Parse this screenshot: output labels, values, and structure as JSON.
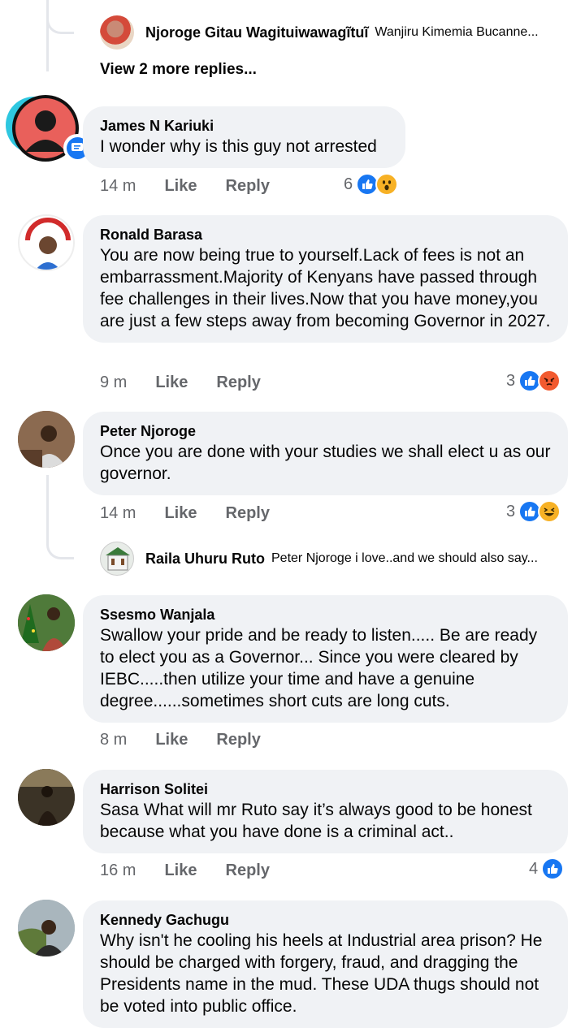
{
  "top_reply": {
    "author": "Njoroge Gitau Wagituiwawagĩtuĩ",
    "snippet": "Wanjiru Kimemia  Bucanne..."
  },
  "view_more_label": "View 2 more replies...",
  "comments": [
    {
      "author": "James N Kariuki",
      "text": "I wonder why is this guy not arrested",
      "time": "14 m",
      "like_label": "Like",
      "reply_label": "Reply",
      "reaction_count": "6",
      "reactions": [
        "like-icon",
        "wow-icon"
      ]
    },
    {
      "author": "Ronald Barasa",
      "text": "You are now being true to yourself.Lack of fees is not an embarrassment.Majority of Kenyans have passed through fee challenges in their lives.Now that you have money,you are just a few steps away from becoming Governor in 2027.",
      "time": "9 m",
      "like_label": "Like",
      "reply_label": "Reply",
      "reaction_count": "3",
      "reactions": [
        "like-icon",
        "angry-icon"
      ]
    },
    {
      "author": "Peter Njoroge",
      "text": "Once you are done with your studies we shall elect u as our governor.",
      "time": "14 m",
      "like_label": "Like",
      "reply_label": "Reply",
      "reaction_count": "3",
      "reactions": [
        "like-icon",
        "laugh-icon"
      ],
      "reply": {
        "author": "Raila Uhuru Ruto",
        "snippet": "Peter Njoroge i love..and we should also say..."
      }
    },
    {
      "author": "Ssesmo Wanjala",
      "text": "Swallow your pride and be ready to listen..... Be are ready to elect you as a Governor... Since you were cleared by IEBC.....then utilize your time and have a genuine degree......sometimes short cuts are long cuts.",
      "time": "8 m",
      "like_label": "Like",
      "reply_label": "Reply"
    },
    {
      "author": "Harrison Solitei",
      "text": "Sasa What will mr Ruto say it’s always good to be honest because what you have done is a criminal act..",
      "time": "16 m",
      "like_label": "Like",
      "reply_label": "Reply",
      "reaction_count": "4",
      "reactions": [
        "like-icon"
      ]
    },
    {
      "author": "Kennedy Gachugu",
      "text": "Why isn't he cooling his heels at Industrial area prison? He should be charged with forgery, fraud, and dragging the Presidents name in the mud. These UDA thugs should not be voted into public office."
    }
  ],
  "colors": {
    "bubble": "#f0f2f5",
    "meta": "#65676b",
    "like": "#1877f2",
    "wow": "#f7b125",
    "angry": "#f25a2f"
  }
}
